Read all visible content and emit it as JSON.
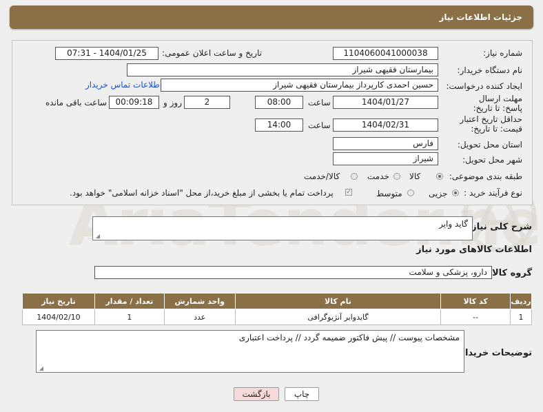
{
  "header": {
    "title": "جزئیات اطلاعات نیاز"
  },
  "form": {
    "need_number": {
      "label": "شماره نیاز:",
      "value": "1104060041000038"
    },
    "announce_datetime": {
      "label": "تاریخ و ساعت اعلان عمومی:",
      "value": "1404/01/25 - 07:31"
    },
    "buyer_org": {
      "label": "نام دستگاه خریدار:",
      "value": "بیمارستان فقیهی شیراز"
    },
    "creator": {
      "label": "ایجاد کننده درخواست:",
      "value": "حسین احمدی کارپرداز بیمارستان فقیهی شیراز",
      "contact_link": "اطلاعات تماس خریدار"
    },
    "response_deadline": {
      "label": "مهلت ارسال پاسخ: تا تاریخ:",
      "date": "1404/01/27",
      "time_label": "ساعت",
      "time": "08:00",
      "days": "2",
      "days_label": "روز و",
      "remaining": "00:09:18",
      "remaining_label": "ساعت باقی مانده"
    },
    "price_validity": {
      "label": "حداقل تاریخ اعتبار قیمت: تا تاریخ:",
      "date": "1404/02/31",
      "time_label": "ساعت",
      "time": "14:00"
    },
    "delivery_province": {
      "label": "استان محل تحویل:",
      "value": "فارس"
    },
    "delivery_city": {
      "label": "شهر محل تحویل:",
      "value": "شیراز"
    },
    "category": {
      "label": "طبقه بندی موضوعی:",
      "options": [
        "کالا",
        "خدمت",
        "کالا/خدمت"
      ],
      "selected": "کالا"
    },
    "process_type": {
      "label": "نوع فرآیند خرید :",
      "options": [
        "جزیی",
        "متوسط"
      ],
      "selected": "جزیی",
      "payment_note": "پرداخت تمام یا بخشی از مبلغ خرید،از محل \"اسناد خزانه اسلامی\" خواهد بود."
    }
  },
  "general_description": {
    "label": "شرح کلی نیاز:",
    "value": "گاید وایر"
  },
  "goods_info": {
    "title": "اطلاعات کالاهای مورد نیاز"
  },
  "goods_group": {
    "label": "گروه کالا:",
    "value": "دارو، پزشکی و سلامت"
  },
  "table": {
    "headers": [
      "ردیف",
      "کد کالا",
      "نام کالا",
      "واحد شمارش",
      "تعداد / مقدار",
      "تاریخ نیاز"
    ],
    "rows": [
      [
        "1",
        "--",
        "گایدوایر آنژیوگرافی",
        "عدد",
        "1",
        "1404/02/10"
      ]
    ]
  },
  "buyer_notes": {
    "label": "توضیحات خریدار:",
    "value": "مشخصات پیوست // پیش فاکتور ضمیمه گردد // پرداخت اعتباری"
  },
  "buttons": {
    "print": "چاپ",
    "back": "بازگشت"
  },
  "watermark": {
    "text": "AriaTender.net"
  },
  "colors": {
    "header_bg": "#8b6f47",
    "link": "#1a4fd6",
    "back_button_bg": "#f6dada"
  }
}
